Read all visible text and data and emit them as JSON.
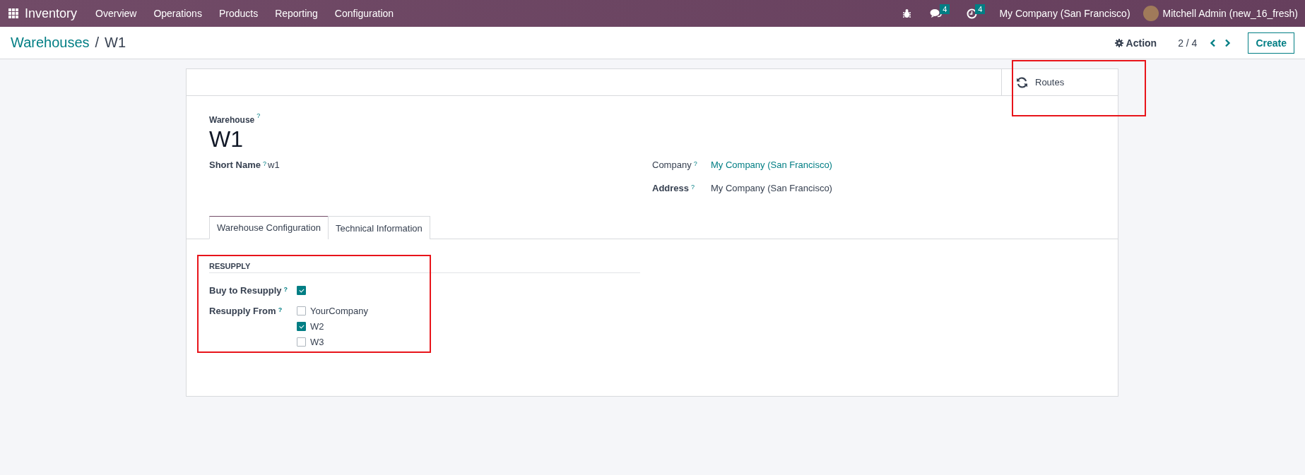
{
  "top_bar": {
    "app_name": "Inventory",
    "menu": [
      "Overview",
      "Operations",
      "Products",
      "Reporting",
      "Configuration"
    ],
    "messages_count": "4",
    "activities_count": "4",
    "company": "My Company (San Francisco)",
    "user": "Mitchell Admin (new_16_fresh)"
  },
  "control_bar": {
    "breadcrumb": {
      "parent": "Warehouses",
      "separator": "/",
      "current": "W1"
    },
    "action": "Action",
    "pager": "2 / 4",
    "create": "Create"
  },
  "smart_buttons": [
    {
      "label": "Routes",
      "highlighted": true
    }
  ],
  "form": {
    "name_label": "Warehouse",
    "help_mark": "?",
    "name": "W1",
    "fields_left": [
      {
        "label": "Short Name",
        "value": "w1",
        "kind": "text"
      }
    ],
    "fields_right": [
      {
        "label": "Company",
        "value": "My Company (San Francisco)",
        "kind": "link"
      },
      {
        "label": "Address",
        "value": "My Company (San Francisco)",
        "kind": "text"
      }
    ]
  },
  "tabs": [
    {
      "label": "Warehouse Configuration",
      "selected": true
    },
    {
      "label": "Technical Information",
      "selected": false
    }
  ],
  "resupply": {
    "title": "RESUPPLY",
    "highlighted": true,
    "buy_label": "Buy to Resupply",
    "buy_checked": true,
    "from_label": "Resupply From",
    "options": [
      {
        "label": "YourCompany",
        "checked": false
      },
      {
        "label": "W2",
        "checked": true
      },
      {
        "label": "W3",
        "checked": false
      }
    ]
  }
}
